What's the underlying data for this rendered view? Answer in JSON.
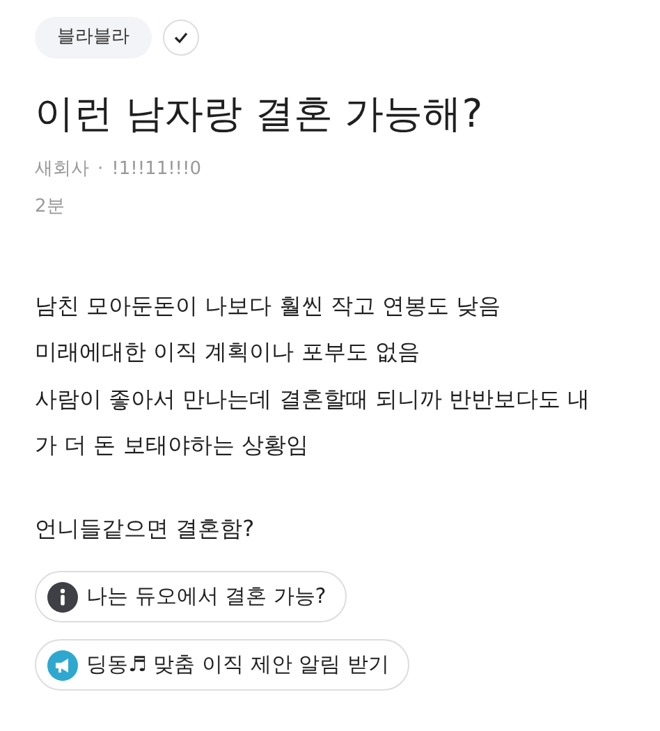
{
  "tag": "블라블라",
  "title": "이런 남자랑 결혼 가능해?",
  "meta": {
    "company": "새회사",
    "separator": "·",
    "author": "!1!!11!!!0"
  },
  "time": "2분",
  "body": [
    [
      "남친 모아둔돈이 나보다 훨씬 작고 연봉도 낮음",
      "미래에대한 이직 계획이나 포부도 없음",
      "사람이 좋아서 만나는데 결혼할때 되니까 반반보다도 내",
      "가 더 돈 보태야하는 상황임"
    ],
    [
      "언니들같으면 결혼함?"
    ]
  ],
  "actions": [
    {
      "kind": "info",
      "label": "나는 듀오에서 결혼 가능?"
    },
    {
      "kind": "alert",
      "label": "딩동♬ 맞춤 이직 제안 알림 받기"
    }
  ]
}
